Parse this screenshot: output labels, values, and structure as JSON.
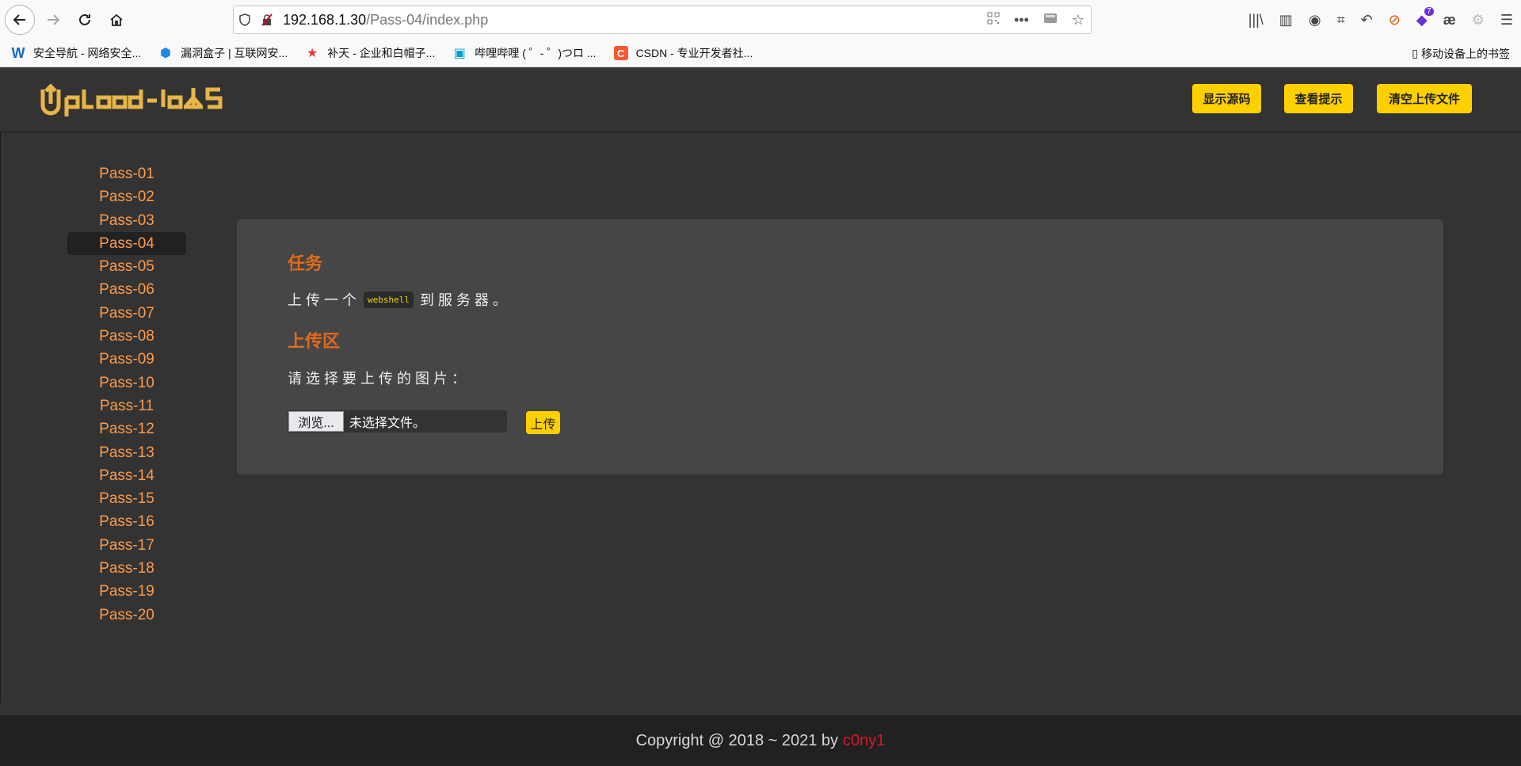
{
  "browser": {
    "url_host": "192.168.1.30",
    "url_path": "/Pass-04/index.php",
    "bookmarks": [
      {
        "label": "安全导航 - 网络安全...",
        "icon": "W",
        "color": "#1565c0"
      },
      {
        "label": "漏洞盒子 | 互联网安...",
        "icon": "⬢",
        "color": "#1e88e5"
      },
      {
        "label": "补天 - 企业和白帽子...",
        "icon": "★",
        "color": "#e53935"
      },
      {
        "label": "哔哩哔哩 ( ゜- ゜)つロ ...",
        "icon": "▣",
        "color": "#00a1d6"
      },
      {
        "label": "CSDN - 专业开发者社...",
        "icon": "C",
        "color": "#fc5531"
      }
    ],
    "mobile_bookmarks": "移动设备上的书签",
    "notification_count": "7"
  },
  "site": {
    "logo_text": "Upload-labs",
    "buttons": {
      "show_source": "显示源码",
      "show_hint": "查看提示",
      "clear_uploads": "清空上传文件"
    },
    "passes": [
      "Pass-01",
      "Pass-02",
      "Pass-03",
      "Pass-04",
      "Pass-05",
      "Pass-06",
      "Pass-07",
      "Pass-08",
      "Pass-09",
      "Pass-10",
      "Pass-11",
      "Pass-12",
      "Pass-13",
      "Pass-14",
      "Pass-15",
      "Pass-16",
      "Pass-17",
      "Pass-18",
      "Pass-19",
      "Pass-20"
    ],
    "active_pass": "Pass-04",
    "task_heading": "任务",
    "task_prefix": "上传一个",
    "task_code": "webshell",
    "task_suffix": "到服务器。",
    "upload_heading": "上传区",
    "choose_label": "请选择要上传的图片：",
    "browse_label": "浏览...",
    "no_file_label": "未选择文件。",
    "upload_label": "上传",
    "footer_text": "Copyright @ 2018 ~ 2021 by",
    "footer_author": "c0ny1"
  },
  "colors": {
    "accent_yellow": "#ffd000",
    "heading_orange": "#e16a1b",
    "link_orange": "#ff9b4a",
    "author_red": "#d6182b"
  }
}
